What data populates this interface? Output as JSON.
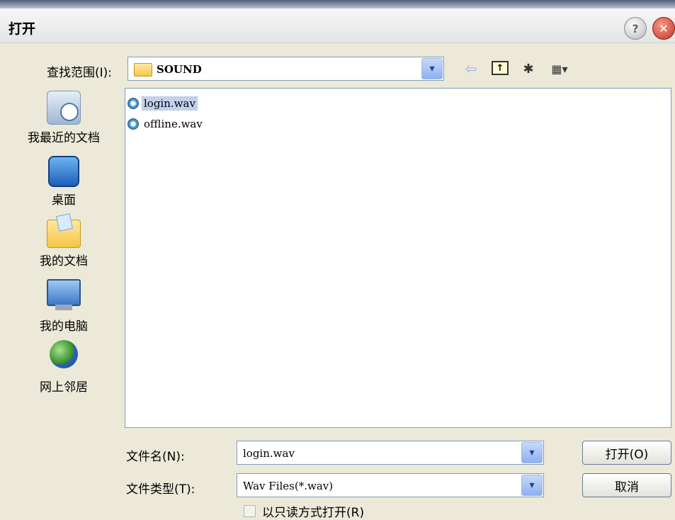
{
  "window": {
    "title": "打开",
    "help_glyph": "?",
    "close_glyph": "✕"
  },
  "look_in": {
    "label": "查找范围(I):",
    "value": "SOUND"
  },
  "toolbar": {
    "back_glyph": "⇦",
    "up_glyph": "↑",
    "new_folder_glyph": "✱",
    "view_glyph": "▦▾"
  },
  "places": [
    {
      "label": "我最近的文档",
      "icon": "recent-documents-icon"
    },
    {
      "label": "桌面",
      "icon": "desktop-icon"
    },
    {
      "label": "我的文档",
      "icon": "my-documents-icon"
    },
    {
      "label": "我的电脑",
      "icon": "my-computer-icon"
    },
    {
      "label": "网上邻居",
      "icon": "network-places-icon"
    }
  ],
  "files": [
    {
      "name": "login.wav",
      "selected": true
    },
    {
      "name": "offline.wav",
      "selected": false
    }
  ],
  "filename": {
    "label": "文件名(N):",
    "value": "login.wav"
  },
  "filetype": {
    "label": "文件类型(T):",
    "value": "Wav Files(*.wav)"
  },
  "buttons": {
    "open": "打开(O)",
    "cancel": "取消"
  },
  "readonly_checkbox": {
    "label": "以只读方式打开(R)",
    "checked": false
  },
  "dropdown_glyph": "▾"
}
